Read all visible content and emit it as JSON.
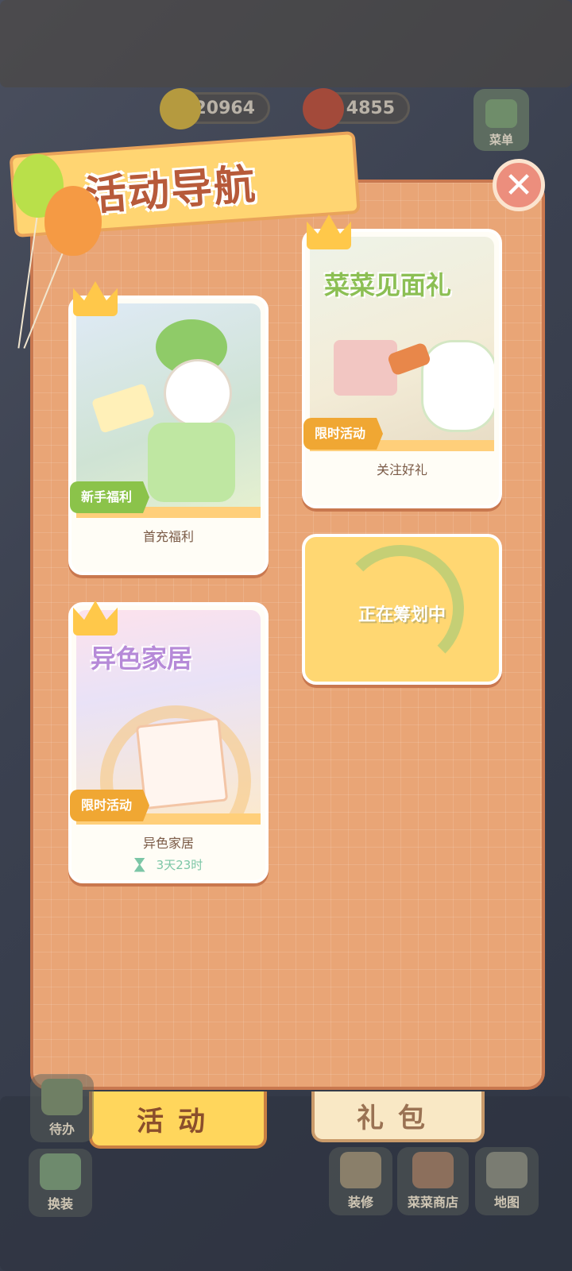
{
  "hud": {
    "coins": "20964",
    "carrots": "4855",
    "menu_label": "菜单"
  },
  "panel": {
    "title": "活动导航",
    "close_glyph": "✕"
  },
  "cards": [
    {
      "id": "first-recharge",
      "tag": "新手福利",
      "tag_color": "#8bc34a",
      "label": "首充福利"
    },
    {
      "id": "follow-gift",
      "tag": "限时活动",
      "tag_color": "#f0a733",
      "label": "关注好礼",
      "art_title": "菜菜见面礼"
    },
    {
      "id": "planning",
      "label": "正在筹划中"
    },
    {
      "id": "alt-home",
      "tag": "限时活动",
      "tag_color": "#f0a733",
      "label": "异色家居",
      "art_title": "异色家居",
      "timer": "3天23时"
    }
  ],
  "tabs": {
    "activity": "活动",
    "gift": "礼包"
  },
  "dock": {
    "todo": "待办",
    "dressup": "换装",
    "decorate": "装修",
    "shop": "菜菜商店",
    "map": "地图"
  },
  "colors": {
    "panel": "#e9a576",
    "accent": "#ffd65c",
    "tag_green": "#8bc34a",
    "tag_orange": "#f0a733"
  }
}
